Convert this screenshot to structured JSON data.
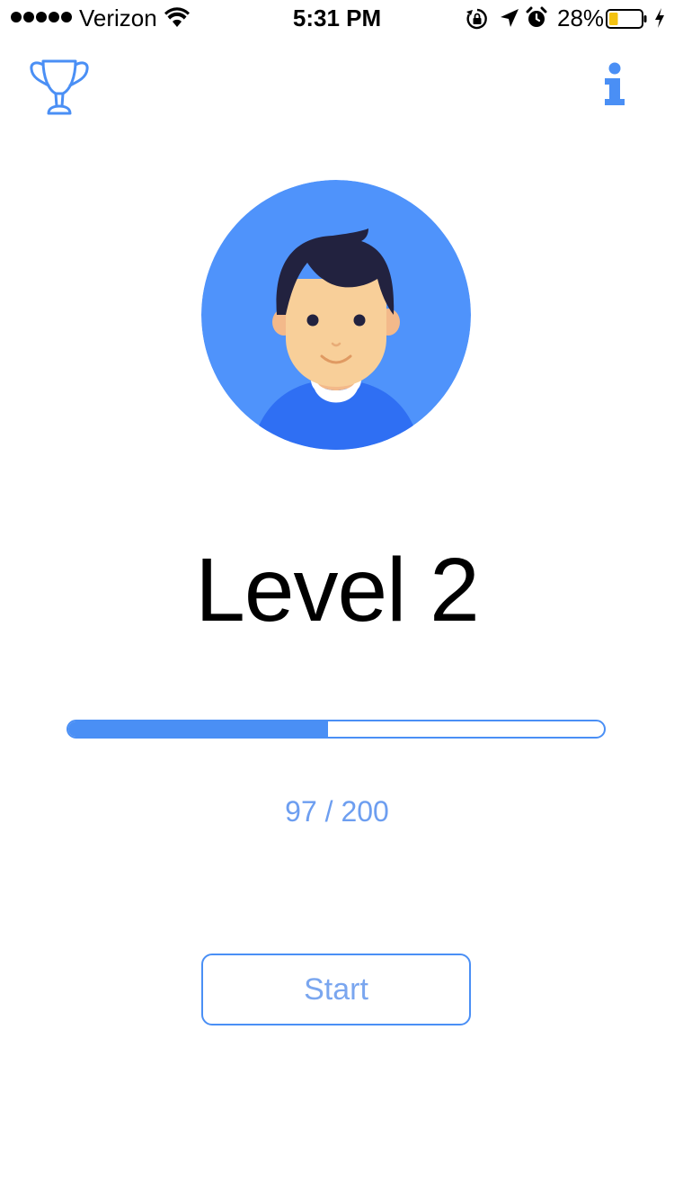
{
  "status_bar": {
    "carrier": "Verizon",
    "time": "5:31 PM",
    "battery_percent": "28%",
    "battery_level": 0.28,
    "icons": [
      "signal-dots-icon",
      "wifi-icon",
      "rotation-lock-icon",
      "location-arrow-icon",
      "alarm-clock-icon",
      "battery-icon",
      "charging-bolt-icon"
    ]
  },
  "nav": {
    "left_icon": "trophy-icon",
    "right_icon": "info-icon"
  },
  "profile": {
    "avatar_icon": "boy-avatar-icon",
    "level_label": "Level 2"
  },
  "progress": {
    "current": 97,
    "total": 200,
    "label": "97 / 200"
  },
  "actions": {
    "start_label": "Start"
  },
  "colors": {
    "accent": "#4a8ff5",
    "avatar_background": "#4f93fb",
    "shirt": "#2f6ff3",
    "hair": "#22223f",
    "skin": "#f8cf99",
    "progress_text": "#6d9ef0",
    "battery_fill": "#f3c211"
  }
}
